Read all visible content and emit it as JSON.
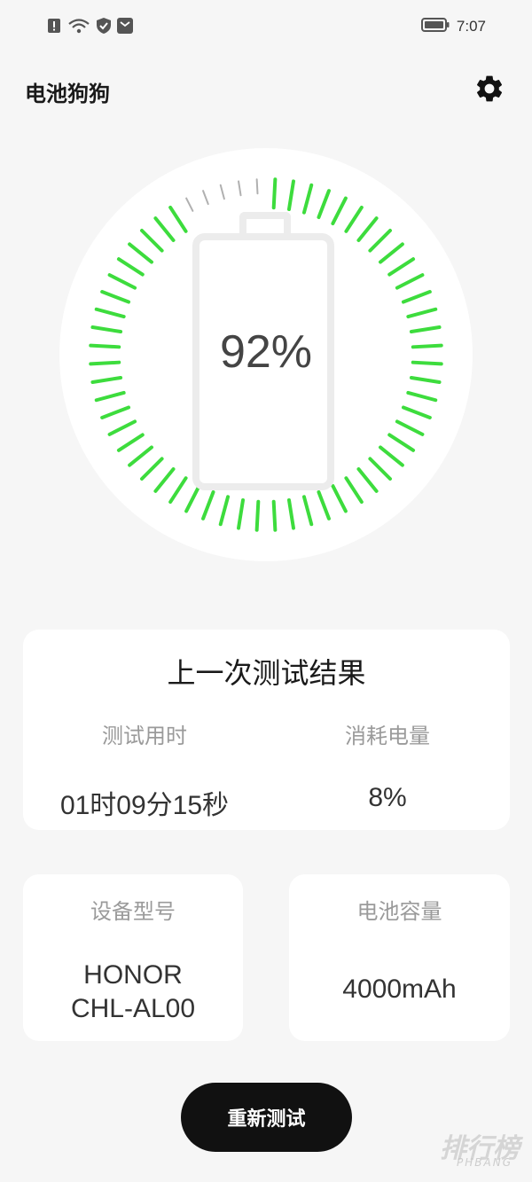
{
  "status_bar": {
    "time": "7:07",
    "icons": [
      "alert-icon",
      "wifi-icon",
      "shield-icon",
      "notification-icon",
      "battery-icon"
    ]
  },
  "header": {
    "title": "电池狗狗",
    "settings_icon": "gear-icon"
  },
  "gauge": {
    "percent_text": "92%",
    "level": 0.92,
    "active_color": "#3ddc3d",
    "inactive_color": "#b0b0b0"
  },
  "last_result": {
    "title": "上一次测试结果",
    "duration_label": "测试用时",
    "duration_value": "01时09分15秒",
    "consumed_label": "消耗电量",
    "consumed_value": "8%"
  },
  "device": {
    "model_label": "设备型号",
    "model_line1": "HONOR",
    "model_line2": "CHL-AL00",
    "capacity_label": "电池容量",
    "capacity_value": "4000mAh"
  },
  "actions": {
    "retest_label": "重新测试"
  },
  "watermark": {
    "text": "排行榜",
    "sub": "PHBANG"
  }
}
